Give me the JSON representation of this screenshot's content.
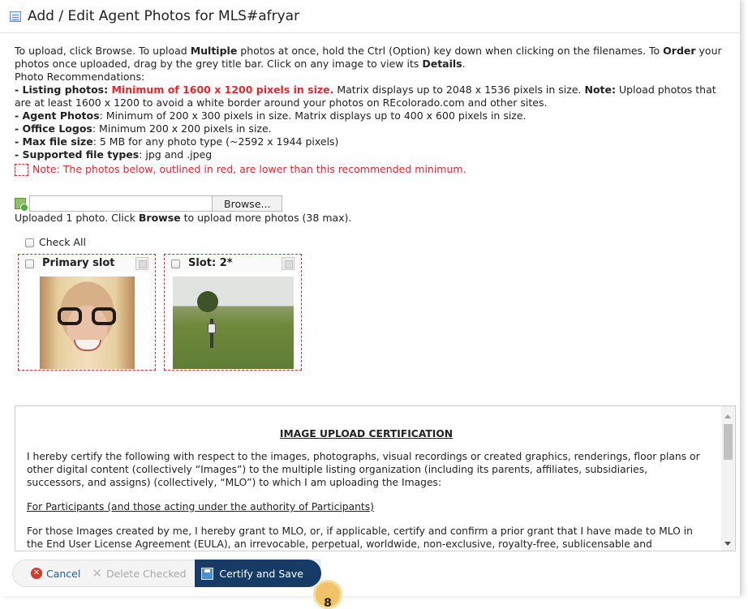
{
  "dialog": {
    "title": "Add / Edit Agent Photos for MLS#afryar"
  },
  "instructions": {
    "intro_a": "To upload, click Browse. To upload ",
    "intro_b": "Multiple",
    "intro_c": " photos at once, hold the Ctrl (Option) key down when clicking on the filenames. To ",
    "intro_d": "Order",
    "intro_e": " your photos once uploaded, drag by the grey title bar. Click on any image to view its ",
    "intro_f": "Details",
    "intro_g": ".",
    "recommendations_heading": "Photo Recommendations:",
    "listing_label": "- Listing photos: ",
    "listing_min": "Minimum of 1600 x 1200 pixels in size.",
    "listing_rest_a": " Matrix displays up to 2048 x 1536 pixels in size. ",
    "listing_note_label": "Note:",
    "listing_rest_b": " Upload photos that are at least 1600 x 1200 to avoid a white border around your photos on REcolorado.com and other sites.",
    "agent_label": "- Agent Photos",
    "agent_text": ": Minimum of 200 x 300 pixels in size. Matrix displays up to 400 x 600 pixels in size.",
    "office_label": "- Office Logos",
    "office_text": ": Minimum 200 x 200 pixels in size.",
    "maxsize_label": "- Max file size",
    "maxsize_text": ": 5 MB for any photo type (~2592 x 1944 pixels)",
    "types_label": "- Supported file types",
    "types_text": ": jpg and .jpeg",
    "red_note": "Note: The photos below, outlined in red, are lower than this recommended minimum."
  },
  "upload": {
    "file_value": "",
    "browse_label": "Browse...",
    "status_a": "Uploaded 1 photo. Click ",
    "status_b": "Browse",
    "status_c": " to upload more photos (38 max)."
  },
  "check_all_label": "Check All",
  "slots": [
    {
      "label": "Primary slot"
    },
    {
      "label": "Slot: 2*"
    }
  ],
  "certification": {
    "title": "IMAGE UPLOAD CERTIFICATION",
    "para1": "I hereby certify the following with respect to the images, photographs, visual recordings or created graphics, renderings, floor plans or other digital content (collectively “Images”) to the multiple listing organization (including its parents, affiliates, subsidiaries, successors, and assigns) (collectively, “MLO”) to which I am uploading the Images:",
    "subheading": "For Participants (and those acting under the authority of Participants)",
    "para2": "For those Images created by me, I hereby grant to MLO, or, if applicable, certify and confirm a prior grant that I have made to MLO in the End User License Agreement (EULA), an irrevocable, perpetual, worldwide, non-exclusive, royalty-free, sublicensable and"
  },
  "footer": {
    "cancel_label": "Cancel",
    "delete_label": "Delete Checked",
    "save_label": "Certify and Save"
  },
  "step_badge": "8"
}
